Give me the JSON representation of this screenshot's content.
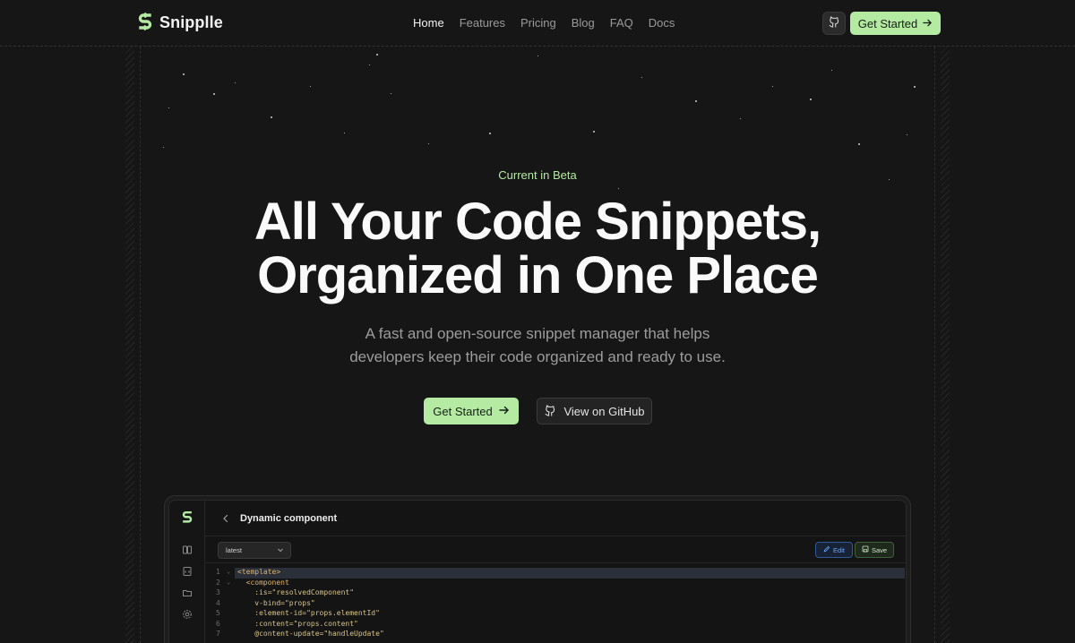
{
  "nav": {
    "brand": "Snipplle",
    "links": [
      {
        "label": "Home",
        "active": true
      },
      {
        "label": "Features",
        "active": false
      },
      {
        "label": "Pricing",
        "active": false
      },
      {
        "label": "Blog",
        "active": false
      },
      {
        "label": "FAQ",
        "active": false
      },
      {
        "label": "Docs",
        "active": false
      }
    ],
    "cta_label": "Get Started"
  },
  "hero": {
    "badge": "Current in Beta",
    "headline_line1": "All Your Code Snippets,",
    "headline_line2": "Organized in One Place",
    "subtitle_line1": "A fast and open-source snippet manager that helps",
    "subtitle_line2": "developers keep their code organized and ready to use.",
    "primary_label": "Get Started",
    "secondary_label": "View on GitHub"
  },
  "app": {
    "title": "Dynamic component",
    "version": "latest",
    "edit_label": "Edit",
    "save_label": "Save",
    "sidebar_icons": [
      "library-icon",
      "snippet-icon",
      "folder-icon",
      "settings-icon"
    ],
    "code": [
      {
        "n": "1",
        "fold": true,
        "text": "<template>"
      },
      {
        "n": "2",
        "fold": true,
        "text": "  <component"
      },
      {
        "n": "3",
        "fold": false,
        "text": "    :is=\"resolvedComponent\""
      },
      {
        "n": "4",
        "fold": false,
        "text": "    v-bind=\"props\""
      },
      {
        "n": "5",
        "fold": false,
        "text": "    :element-id=\"props.elementId\""
      },
      {
        "n": "6",
        "fold": false,
        "text": "    :content=\"props.content\""
      },
      {
        "n": "7",
        "fold": false,
        "text": "    @content-update=\"handleUpdate\""
      }
    ]
  },
  "colors": {
    "accent": "#b5eaa3",
    "background": "#161616",
    "edit_blue": "#6ea8ff"
  }
}
